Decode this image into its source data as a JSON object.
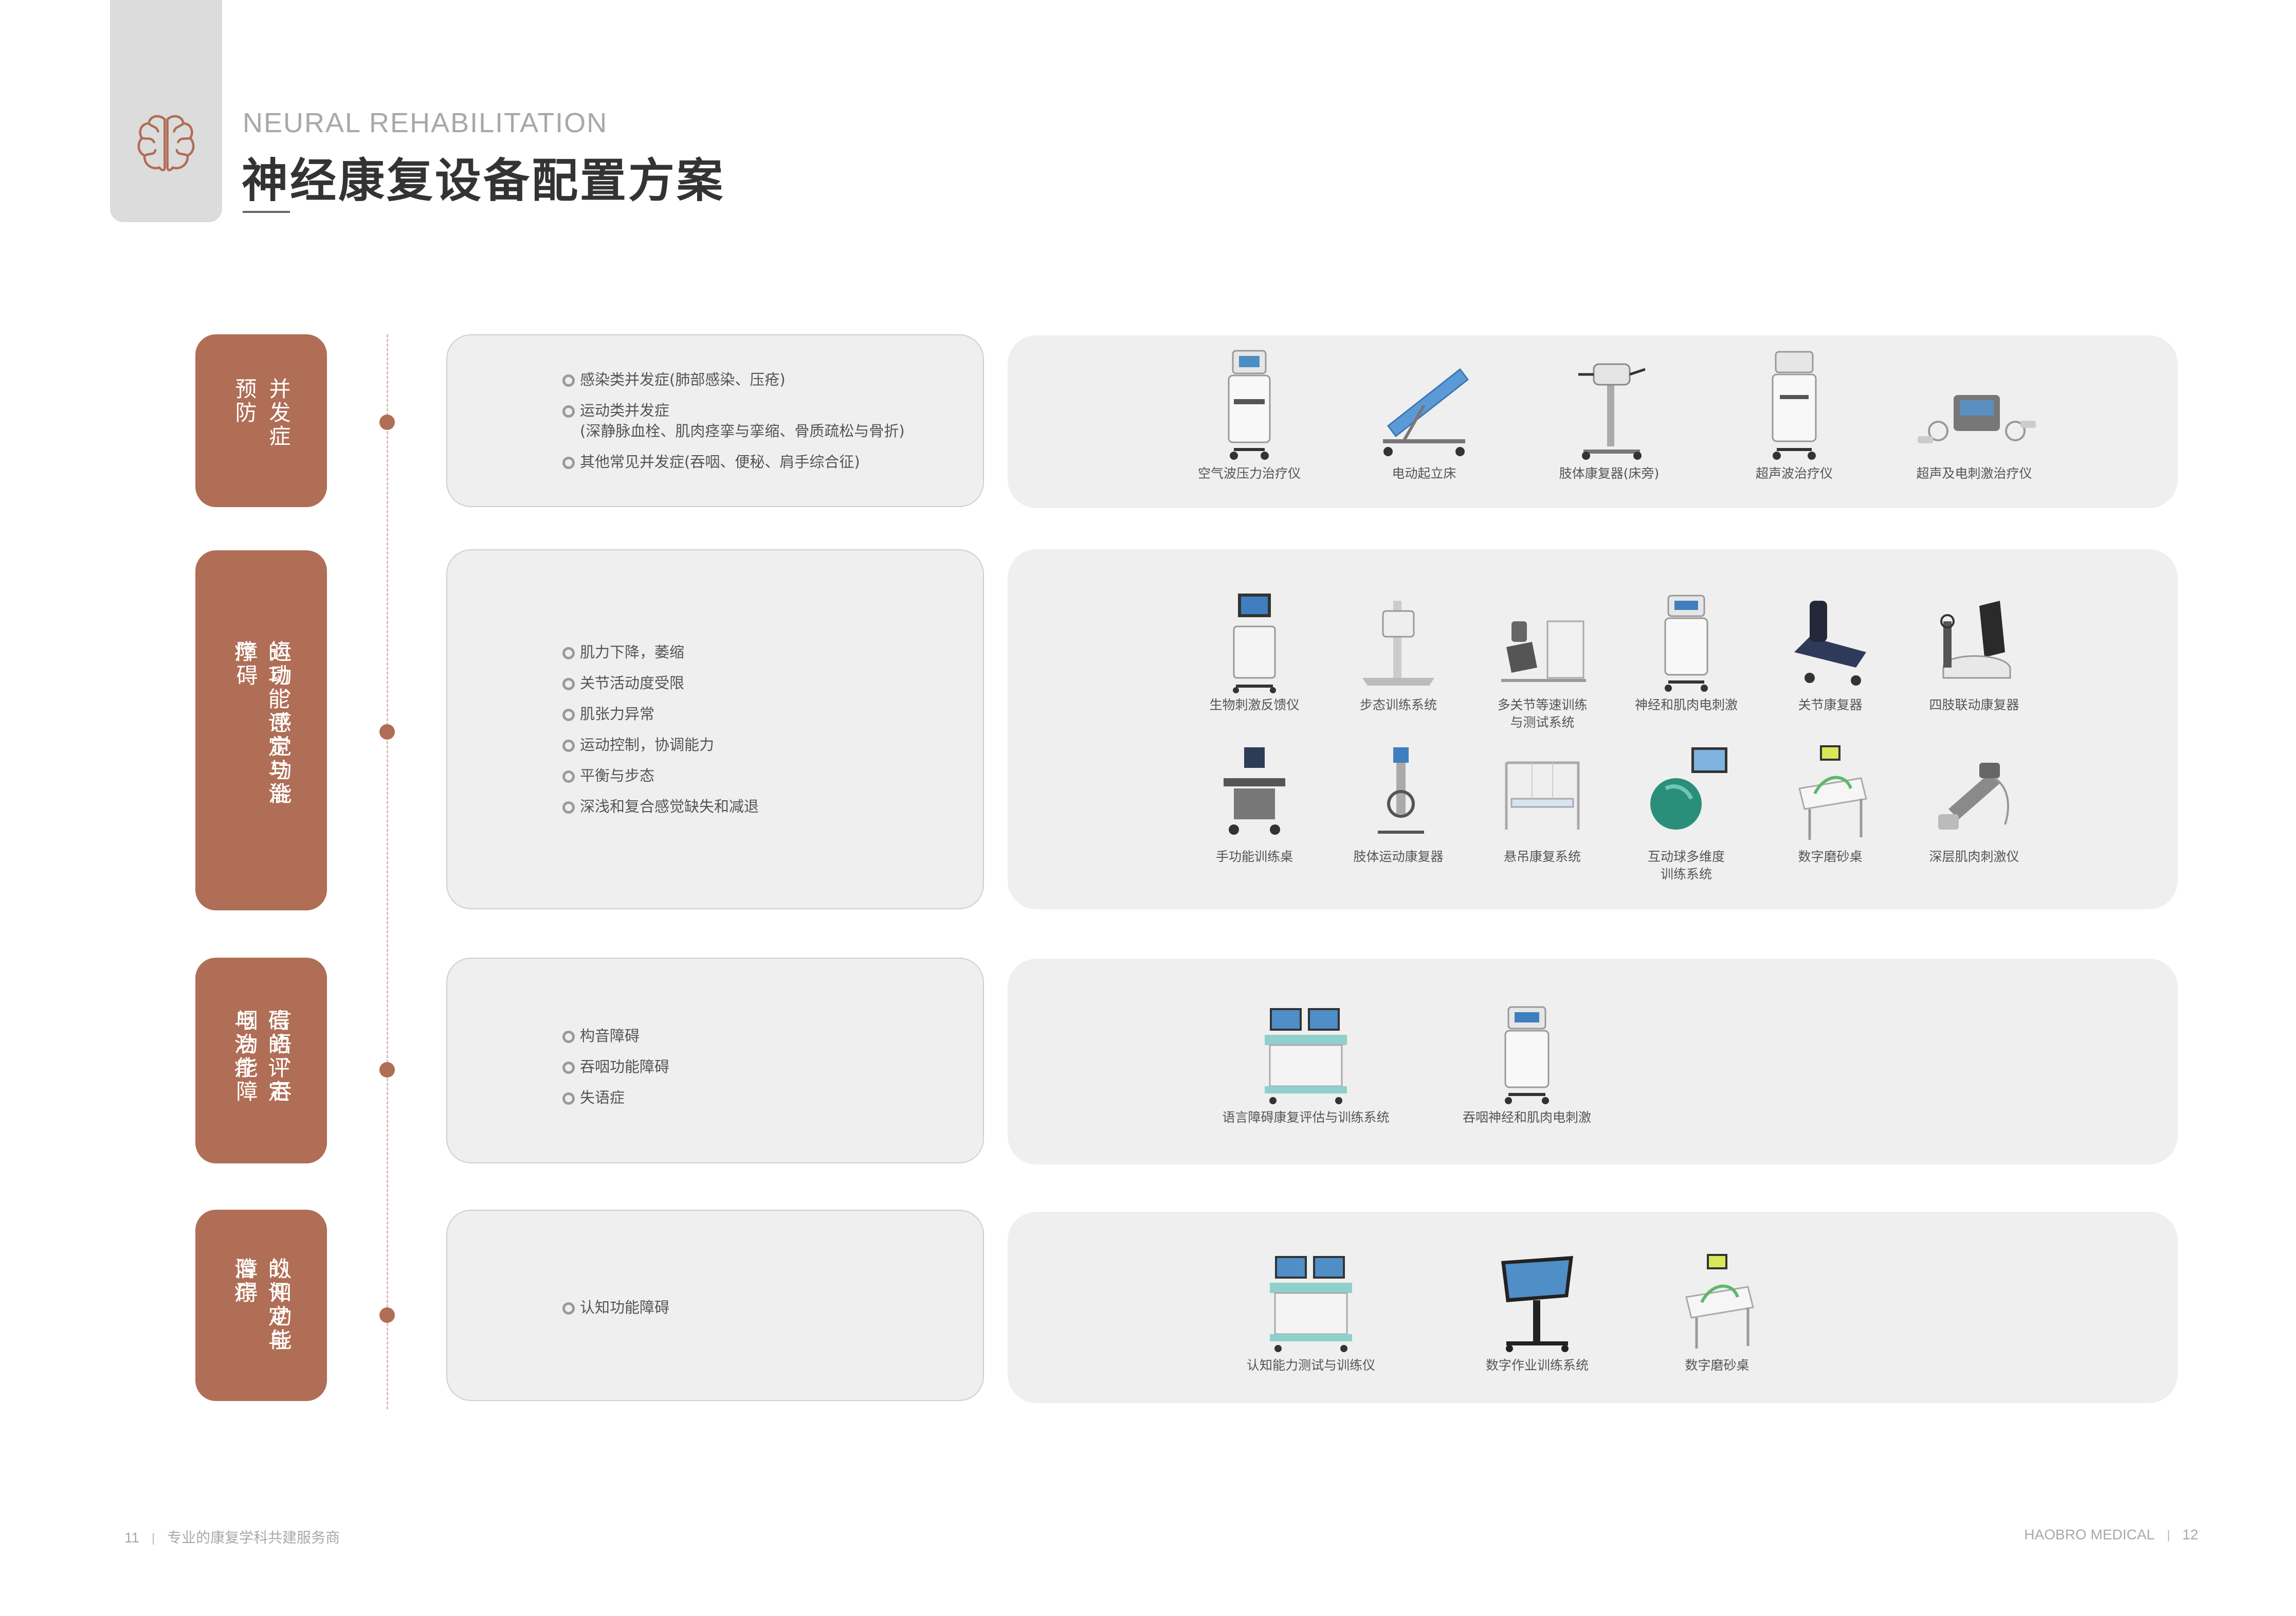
{
  "header": {
    "title_en": "NEURAL REHABILITATION",
    "title_cn": "神经康复设备配置方案",
    "icon": "brain-icon",
    "accent_color": "#b06e56"
  },
  "sections": [
    {
      "category": "并发症预防",
      "bullets": [
        "感染类并发症(肺部感染、压疮)",
        "运动类并发症",
        "(深静脉血栓、肌肉痉挛与挛缩、骨质疏松与骨折)",
        "其他常见并发症(吞咽、便秘、肩手综合征)"
      ],
      "products": [
        "空气波压力治疗仪",
        "电动起立床",
        "肢体康复器(床旁)",
        "超声波治疗仪",
        "超声及电刺激治疗仪"
      ]
    },
    {
      "category_col1": "运动、感觉功能障碍",
      "category_col2": "的功能评定与治疗",
      "bullets": [
        "肌力下降，萎缩",
        "关节活动度受限",
        "肌张力异常",
        "运动控制，协调能力",
        "平衡与步态",
        "深浅和复合感觉缺失和减退"
      ],
      "products": [
        "生物刺激反馈仪",
        "步态训练系统",
        "多关节等速训练\n与测试系统",
        "神经和肌肉电刺激",
        "关节康复器",
        "四肢联动康复器",
        "手功能训练桌",
        "肢体运动康复器",
        "悬吊康复系统",
        "互动球多维度\n训练系统",
        "数字磨砂桌",
        "深层肌肉刺激仪"
      ]
    },
    {
      "category_col1": "言语、吞咽功能障",
      "category_col2": "碍的评定与治疗",
      "bullets": [
        "构音障碍",
        "吞咽功能障碍",
        "失语症"
      ],
      "products": [
        "语言障碍康复评估与训练系统",
        "吞咽神经和肌肉电刺激"
      ]
    },
    {
      "category_col1": "认知功能障碍",
      "category_col2": "的评定与治疗",
      "bullets": [
        "认知功能障碍"
      ],
      "products": [
        "认知能力测试与训练仪",
        "数字作业训练系统",
        "数字磨砂桌"
      ]
    }
  ],
  "footer": {
    "left_page": "11",
    "left_text": "专业的康复学科共建服务商",
    "right_text": "HAOBRO MEDICAL",
    "right_page": "12"
  }
}
